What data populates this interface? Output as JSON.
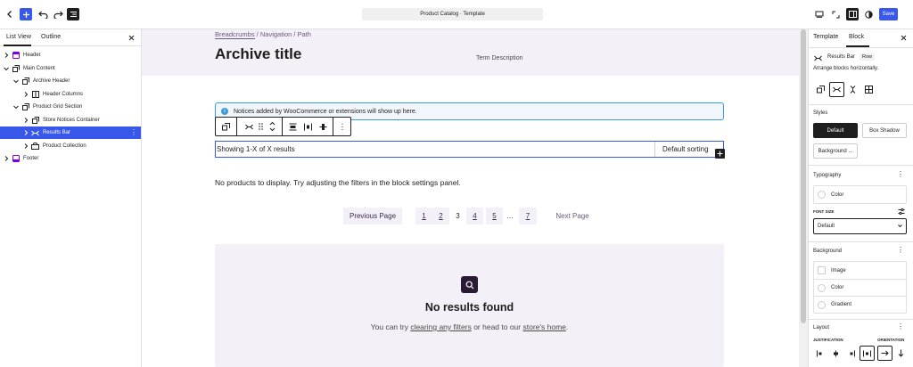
{
  "topbar": {
    "document_title": "Product Catalog · Template",
    "save_label": "Save"
  },
  "left_panel": {
    "tabs": [
      "List View",
      "Outline"
    ],
    "tree": [
      {
        "label": "Header",
        "icon": "template-part-icon"
      },
      {
        "label": "Main Content",
        "icon": "group-icon"
      },
      {
        "label": "Archive Header",
        "icon": "group-icon"
      },
      {
        "label": "Header Columns",
        "icon": "columns-icon"
      },
      {
        "label": "Product Grid Section",
        "icon": "group-icon"
      },
      {
        "label": "Store Notices Container",
        "icon": "group-icon"
      },
      {
        "label": "Results Bar",
        "icon": "row-icon"
      },
      {
        "label": "Product Collection",
        "icon": "product-collection-icon"
      },
      {
        "label": "Footer",
        "icon": "template-part-icon"
      }
    ]
  },
  "canvas": {
    "breadcrumbs": "Breadcrumbs / Navigation / Path",
    "archive_title": "Archive title",
    "term_description": "Term Description",
    "notice": "Notices added by WooCommerce or extensions will show up here.",
    "results_count": "Showing 1-X of X results",
    "sorting": "Default sorting",
    "no_products": "No products to display. Try adjusting the filters in the block settings panel.",
    "pagination": {
      "previous": "Previous Page",
      "pages": [
        "1",
        "2",
        "3",
        "4",
        "5",
        "…",
        "7"
      ],
      "current": "3",
      "next": "Next Page"
    },
    "no_results": {
      "title": "No results found",
      "text_before": "You can try ",
      "link1": "clearing any filters",
      "text_middle": " or head to our ",
      "link2": "store's home",
      "text_after": "."
    }
  },
  "right_panel": {
    "tabs": [
      "Template",
      "Block"
    ],
    "active_tab": "Block",
    "block_name": "Results Bar",
    "block_badge": "Row",
    "block_description": "Arrange blocks horizontally.",
    "styles_title": "Styles",
    "styles": [
      "Default",
      "Box Shadow",
      "Background ..."
    ],
    "typography_title": "Typography",
    "typography_color": "Color",
    "font_size_label": "FONT SIZE",
    "font_size_value": "Default",
    "background_title": "Background",
    "background_items": [
      "Image",
      "Color",
      "Gradient"
    ],
    "layout_title": "Layout",
    "justification_label": "JUSTIFICATION",
    "orientation_label": "ORIENTATION"
  },
  "colors": {
    "accent": "#3858e9",
    "header_bg": "#f4f0f7",
    "text": "#1e1e1e"
  }
}
